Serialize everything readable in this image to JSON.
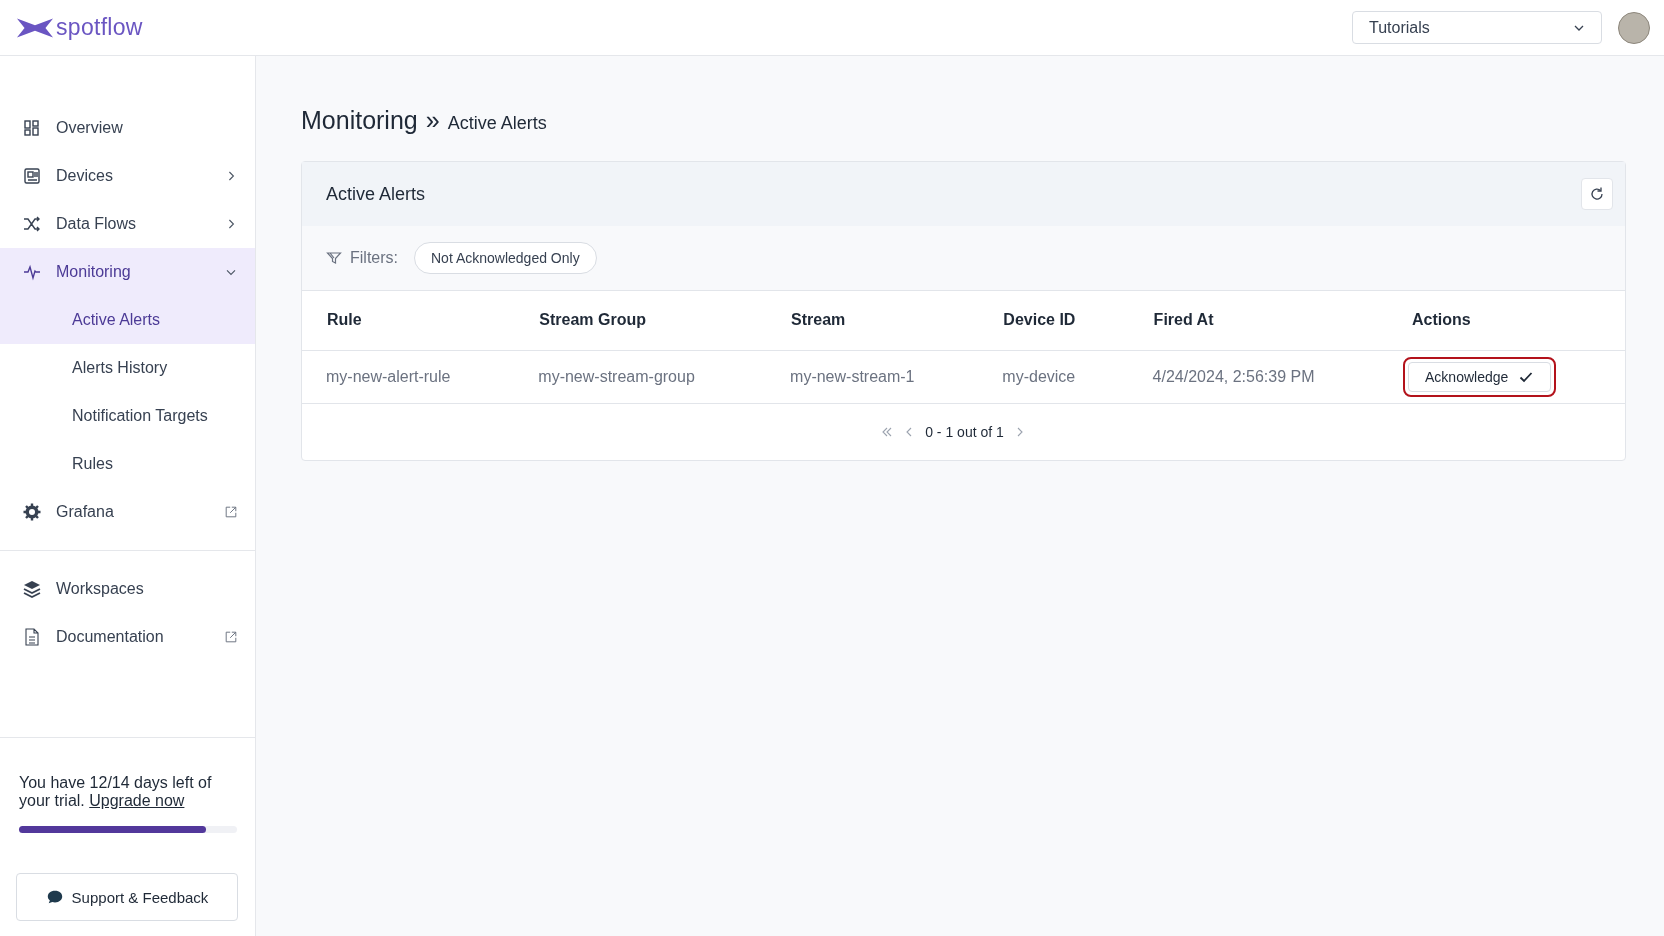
{
  "logo": {
    "text": "spotflow"
  },
  "topbar": {
    "workspace_select": {
      "value": "Tutorials"
    }
  },
  "sidebar": {
    "nav": [
      {
        "label": "Overview",
        "kind": "link",
        "selected": false
      },
      {
        "label": "Devices",
        "kind": "group",
        "expanded": false,
        "selected": false
      },
      {
        "label": "Data Flows",
        "kind": "group",
        "expanded": false,
        "selected": false
      },
      {
        "label": "Monitoring",
        "kind": "group",
        "expanded": true,
        "selected": true,
        "children": [
          {
            "label": "Active Alerts",
            "selected": true
          },
          {
            "label": "Alerts History",
            "selected": false
          },
          {
            "label": "Notification Targets",
            "selected": false
          },
          {
            "label": "Rules",
            "selected": false
          }
        ]
      },
      {
        "label": "Grafana",
        "kind": "external",
        "selected": false
      }
    ],
    "secondary_nav": [
      {
        "label": "Workspaces",
        "kind": "link",
        "selected": false
      },
      {
        "label": "Documentation",
        "kind": "external",
        "selected": false
      }
    ],
    "trial": {
      "text": "You have 12/14 days left of your trial.",
      "link": "Upgrade now",
      "level": 0.857
    },
    "support_button": "Support & Feedback"
  },
  "breadcrumb": {
    "title": "Monitoring",
    "separator": "»",
    "current": "Active Alerts"
  },
  "card": {
    "title": "Active Alerts",
    "filters_label": "Filters:",
    "filter_chips": [
      "Not Acknowledged Only"
    ],
    "table": {
      "columns": [
        "Rule",
        "Stream Group",
        "Stream",
        "Device ID",
        "Fired At",
        "Actions"
      ],
      "rows": [
        {
          "cells": [
            "my-new-alert-rule",
            "my-new-stream-group",
            "my-new-stream-1",
            "my-device",
            "4/24/2024, 2:56:39 PM"
          ],
          "action": {
            "label": "Acknowledge",
            "highlighted": true
          }
        }
      ]
    },
    "pagination": {
      "text": "0 - 1 out of 1"
    }
  }
}
